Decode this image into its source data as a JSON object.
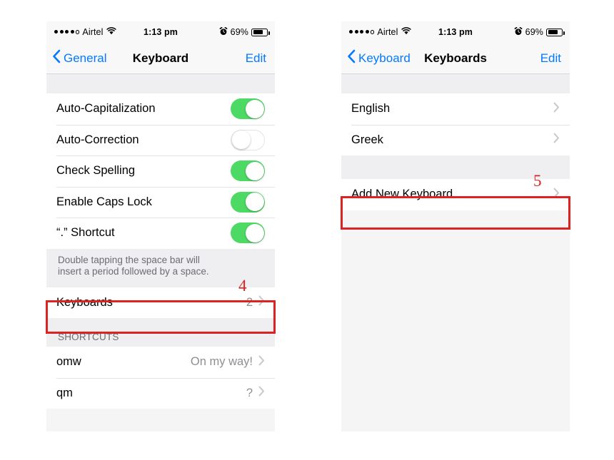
{
  "status_bar": {
    "signal_dots_filled": 4,
    "signal_dots_total": 5,
    "carrier": "Airtel",
    "wifi_icon": "wifi-icon",
    "time": "1:13 pm",
    "alarm_icon": "alarm-clock-icon",
    "battery_percent": "69%",
    "battery_icon": "battery-icon"
  },
  "colors": {
    "accent_blue": "#0479ff",
    "toggle_on_green": "#4cd964",
    "annotation_red": "#dd2222",
    "group_background": "#efeef1",
    "secondary_text": "#8e8e93"
  },
  "left_screen": {
    "nav": {
      "back_label": "General",
      "back_icon": "chevron-left-icon",
      "title": "Keyboard",
      "edit_label": "Edit"
    },
    "toggles": [
      {
        "label": "Auto-Capitalization",
        "state": "on"
      },
      {
        "label": "Auto-Correction",
        "state": "off"
      },
      {
        "label": "Check Spelling",
        "state": "on"
      },
      {
        "label": "Enable Caps Lock",
        "state": "on"
      },
      {
        "label": "“.” Shortcut",
        "state": "on"
      }
    ],
    "note": {
      "line1": "Double tapping the space bar will",
      "line2": "insert a period followed by a space."
    },
    "keyboards_row": {
      "label": "Keyboards",
      "value": "2",
      "chevron_icon": "chevron-right-icon"
    },
    "shortcuts_section": {
      "header": "SHORTCUTS",
      "rows": [
        {
          "label": "omw",
          "value": "On my way!",
          "chevron_icon": "chevron-right-icon"
        },
        {
          "label": "qm",
          "value": "?",
          "chevron_icon": "chevron-right-icon"
        }
      ]
    },
    "annotation": "4"
  },
  "right_screen": {
    "nav": {
      "back_label": "Keyboard",
      "back_icon": "chevron-left-icon",
      "title": "Keyboards",
      "edit_label": "Edit"
    },
    "keyboard_rows": [
      {
        "label": "English",
        "chevron_icon": "chevron-right-icon"
      },
      {
        "label": "Greek",
        "chevron_icon": "chevron-right-icon"
      }
    ],
    "add_row": {
      "label": "Add New Keyboard...",
      "chevron_icon": "chevron-right-icon"
    },
    "annotation": "5"
  }
}
